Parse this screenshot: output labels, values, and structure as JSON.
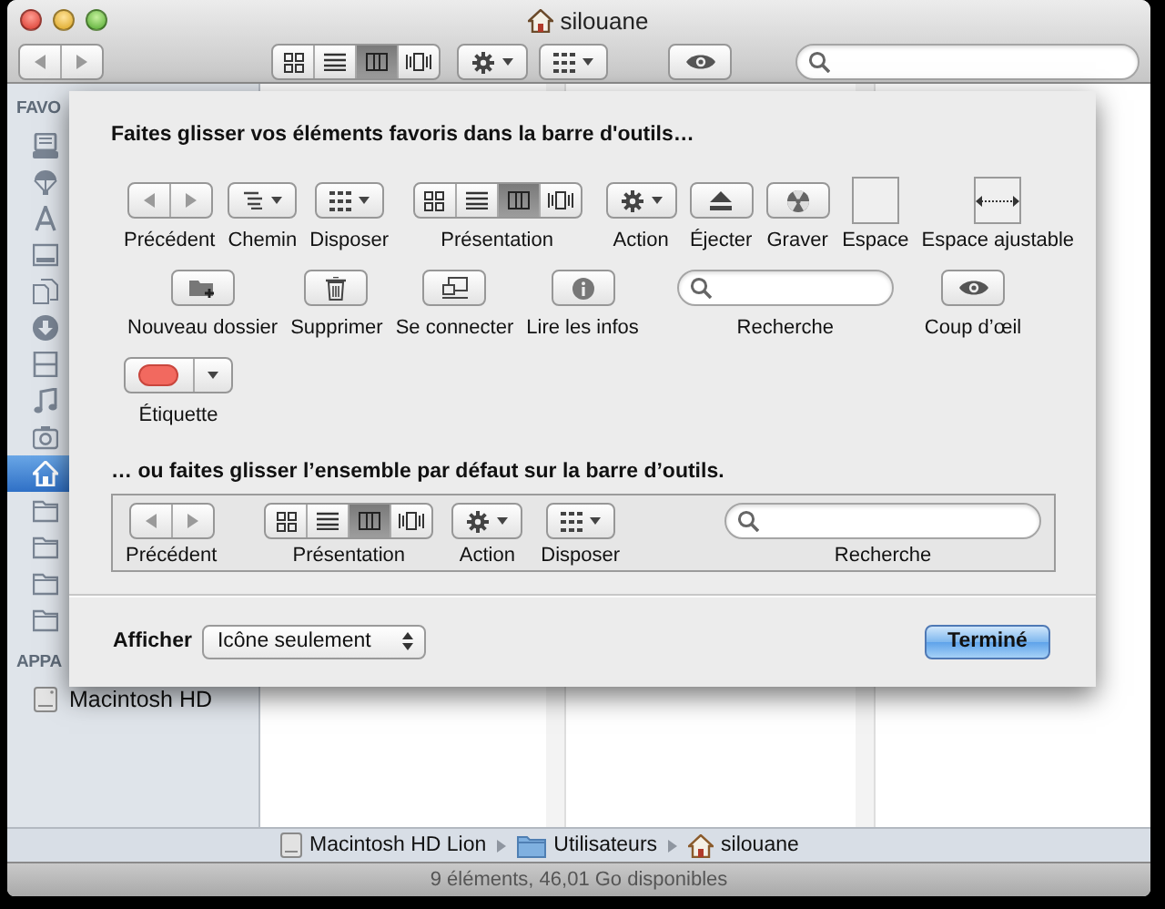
{
  "window": {
    "title": "silouane"
  },
  "toolbar": {
    "items": [
      {
        "kind": "nav"
      },
      {
        "kind": "view",
        "segments": [
          {
            "kind": "icons",
            "selected": false
          },
          {
            "kind": "list",
            "selected": false
          },
          {
            "kind": "columns",
            "selected": true
          },
          {
            "kind": "coverflow",
            "selected": false
          }
        ]
      },
      {
        "kind": "action"
      },
      {
        "kind": "arrange"
      },
      {
        "kind": "quicklook"
      },
      {
        "kind": "search"
      }
    ]
  },
  "sidebar": {
    "sections": [
      {
        "title": "FAVO",
        "items": [
          {
            "kind": "drawer",
            "selected": false
          },
          {
            "kind": "airdrop",
            "selected": false
          },
          {
            "kind": "apps",
            "selected": false
          },
          {
            "kind": "desktop",
            "selected": false
          },
          {
            "kind": "documents",
            "selected": false
          },
          {
            "kind": "downloads",
            "selected": false
          },
          {
            "kind": "movies",
            "selected": false
          },
          {
            "kind": "music",
            "selected": false
          },
          {
            "kind": "pictures",
            "selected": false
          },
          {
            "kind": "home",
            "selected": true
          },
          {
            "kind": "folder",
            "selected": false
          },
          {
            "kind": "folder",
            "selected": false
          },
          {
            "kind": "folder",
            "selected": false
          },
          {
            "kind": "folder",
            "selected": false
          }
        ]
      },
      {
        "title": "APPA",
        "items": [
          {
            "kind": "disk",
            "label": "Macintosh HD",
            "selected": false
          }
        ]
      }
    ]
  },
  "sheet": {
    "title": "Faites glisser vos éléments favoris dans la barre d'outils…",
    "rows": [
      {
        "items": [
          {
            "kind": "nav",
            "label": "Précédent"
          },
          {
            "kind": "path",
            "label": "Chemin"
          },
          {
            "kind": "arrange",
            "label": "Disposer"
          },
          {
            "kind": "view",
            "label": "Présentation",
            "segments": [
              {
                "kind": "icons",
                "selected": false
              },
              {
                "kind": "list",
                "selected": false
              },
              {
                "kind": "columns",
                "selected": true
              },
              {
                "kind": "coverflow",
                "selected": false
              }
            ]
          },
          {
            "kind": "action",
            "label": "Action"
          },
          {
            "kind": "eject",
            "label": "Éjecter"
          },
          {
            "kind": "burn",
            "label": "Graver"
          },
          {
            "kind": "space",
            "label": "Espace"
          },
          {
            "kind": "flexspace",
            "label": "Espace ajustable"
          }
        ]
      },
      {
        "items": [
          {
            "kind": "newfolder",
            "label": "Nouveau dossier"
          },
          {
            "kind": "delete",
            "label": "Supprimer"
          },
          {
            "kind": "connect",
            "label": "Se connecter"
          },
          {
            "kind": "info",
            "label": "Lire les infos"
          },
          {
            "kind": "search",
            "label": "Recherche"
          },
          {
            "kind": "quicklook",
            "label": "Coup d’œil"
          }
        ]
      },
      {
        "items": [
          {
            "kind": "label",
            "label": "Étiquette"
          }
        ]
      }
    ],
    "default_title": "… ou faites glisser l’ensemble par défaut sur la barre d’outils.",
    "default_items": [
      {
        "kind": "nav",
        "label": "Précédent"
      },
      {
        "kind": "view",
        "label": "Présentation",
        "segments": [
          {
            "kind": "icons",
            "selected": false
          },
          {
            "kind": "list",
            "selected": false
          },
          {
            "kind": "columns",
            "selected": true
          },
          {
            "kind": "coverflow",
            "selected": false
          }
        ]
      },
      {
        "kind": "action",
        "label": "Action"
      },
      {
        "kind": "arrange",
        "label": "Disposer"
      },
      {
        "kind": "search",
        "label": "Recherche"
      }
    ],
    "show": {
      "label": "Afficher",
      "value": "Icône seulement"
    },
    "done_button": "Terminé"
  },
  "path_bar": [
    {
      "kind": "disk",
      "label": "Macintosh HD Lion"
    },
    {
      "kind": "folder",
      "label": "Utilisateurs"
    },
    {
      "kind": "home",
      "label": "silouane"
    }
  ],
  "status_bar": "9 éléments, 46,01 Go disponibles"
}
